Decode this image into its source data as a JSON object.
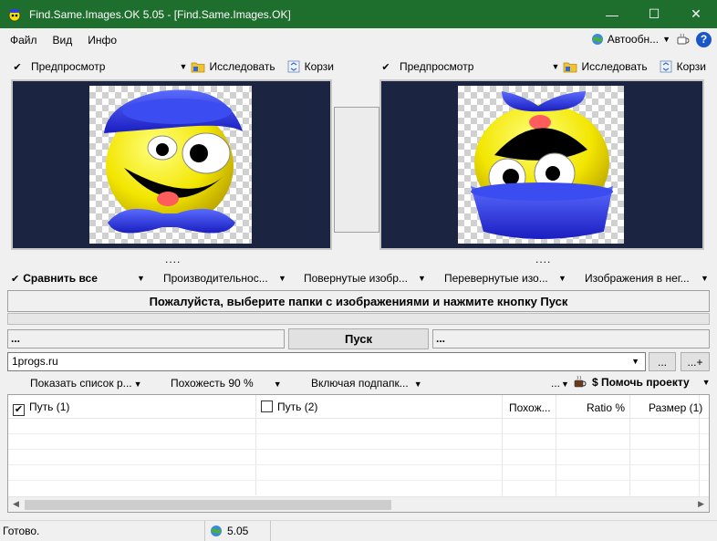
{
  "window": {
    "title": "Find.Same.Images.OK 5.05 - [Find.Same.Images.OK]",
    "minimize_glyph": "—",
    "maximize_glyph": "☐",
    "close_glyph": "✕"
  },
  "menu": {
    "items": [
      "Файл",
      "Вид",
      "Инфо"
    ],
    "auto_update_label": "Автообн...",
    "help_glyph": "?"
  },
  "left_panel": {
    "preview_label": "Предпросмотр",
    "explore_label": "Исследовать",
    "trash_label": "Корзи",
    "dots": "...."
  },
  "right_panel": {
    "preview_label": "Предпросмотр",
    "explore_label": "Исследовать",
    "trash_label": "Корзи",
    "dots": "...."
  },
  "compare_bar": {
    "items": [
      "Сравнить все",
      "Производительнос...",
      "Повернутые изобр...",
      "Перевернутые изо...",
      "Изображения в нег..."
    ]
  },
  "status_message": "Пожалуйста, выберите папки с изображениями и нажмите кнопку Пуск",
  "progress": {
    "value": 0
  },
  "path_left": "...",
  "path_right": "...",
  "start_button": "Пуск",
  "folder_combo": {
    "value": "1progs.ru"
  },
  "browse_button": "...",
  "add_button": "...+",
  "options_bar": {
    "show_list": "Показать список р...",
    "similarity": "Похожесть 90 %",
    "subfolders": "Включая подпапк...",
    "more": "...",
    "donate": "$ Помочь проекту"
  },
  "table": {
    "columns": [
      "Путь (1)",
      "Путь (2)",
      "Похож...",
      "Ratio %",
      "Размер (1)"
    ],
    "path1_checked": true,
    "path2_checked": false,
    "rows": []
  },
  "statusbar": {
    "state": "Готово.",
    "version": "5.05"
  },
  "colors": {
    "titlebar": "#1e6e2e",
    "preview_bg": "#1b2440"
  },
  "icons": {
    "check": "✔",
    "dropdown": "▼"
  }
}
